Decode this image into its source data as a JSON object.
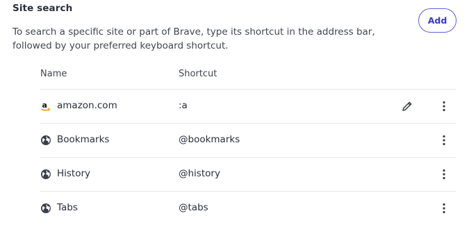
{
  "section": {
    "title": "Site search",
    "description": "To search a specific site or part of Brave, type its shortcut in the address bar, followed by your preferred keyboard shortcut.",
    "add_label": "Add"
  },
  "table": {
    "headers": {
      "name": "Name",
      "shortcut": "Shortcut"
    },
    "rows": [
      {
        "name": "amazon.com",
        "shortcut": ":a",
        "icon": "amazon-icon",
        "editable": true
      },
      {
        "name": "Bookmarks",
        "shortcut": "@bookmarks",
        "icon": "globe-icon",
        "editable": false
      },
      {
        "name": "History",
        "shortcut": "@history",
        "icon": "globe-icon",
        "editable": false
      },
      {
        "name": "Tabs",
        "shortcut": "@tabs",
        "icon": "globe-icon",
        "editable": false
      }
    ]
  },
  "colors": {
    "accent": "#3a36c4",
    "accent_border": "#5f5ce0",
    "divider": "#e6e7ea",
    "text": "#2b2e3a"
  }
}
